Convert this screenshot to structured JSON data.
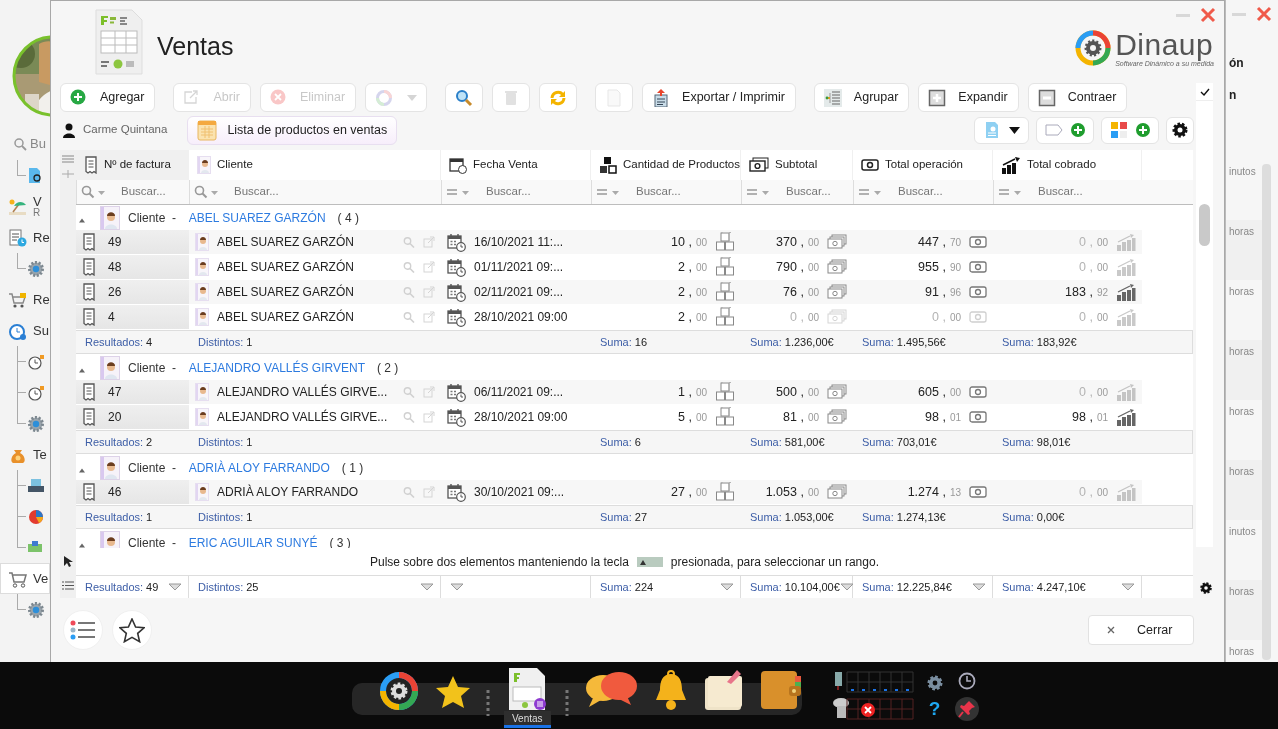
{
  "sidebar": {
    "search_placeholder": "Bu",
    "top_children": [
      {
        "kind": "document"
      }
    ],
    "items": [
      {
        "label": "V",
        "sublabel": "R",
        "kind": "beach",
        "selected": false
      },
      {
        "label": "Re",
        "kind": "report",
        "selected": false,
        "children": [
          {
            "kind": "gear"
          }
        ]
      },
      {
        "label": "Re",
        "kind": "cart-lock",
        "selected": false
      },
      {
        "label": "Su",
        "kind": "clock-gear",
        "selected": false,
        "children": [
          {
            "kind": "clock"
          },
          {
            "kind": "clock"
          },
          {
            "kind": "gear"
          }
        ]
      },
      {
        "label": "Te",
        "kind": "money-bag",
        "selected": false,
        "children": [
          {
            "kind": "register"
          },
          {
            "kind": "pie"
          },
          {
            "kind": "cash"
          }
        ]
      },
      {
        "label": "Ve",
        "kind": "cart",
        "selected": true,
        "children": [
          {
            "kind": "gear"
          }
        ]
      }
    ]
  },
  "window": {
    "title": "Ventas",
    "logo": {
      "name": "Dinaup",
      "tagline": "Software Dinámico a su medida"
    }
  },
  "toolbar": [
    {
      "kind": "add",
      "label": "Agregar",
      "disabled": false
    },
    {
      "kind": "open",
      "label": "Abrir",
      "disabled": true
    },
    {
      "kind": "delete",
      "label": "Eliminar",
      "disabled": true
    },
    {
      "kind": "color",
      "disabled": true
    },
    {
      "kind": "search",
      "disabled": false
    },
    {
      "kind": "trash",
      "disabled": true
    },
    {
      "kind": "refresh",
      "disabled": false
    },
    {
      "kind": "document",
      "disabled": true
    },
    {
      "kind": "export",
      "label": "Exportar / Imprimir",
      "disabled": false
    },
    {
      "kind": "group",
      "label": "Agrupar",
      "disabled": false
    },
    {
      "kind": "expand",
      "label": "Expandir",
      "disabled": false
    },
    {
      "kind": "collapse",
      "label": "Contraer",
      "disabled": false
    }
  ],
  "user": "Carme Quintana",
  "tab": {
    "label": "Lista de productos en ventas",
    "selected": true
  },
  "tools": [
    {
      "kind": "document-menu"
    },
    {
      "kind": "tag-add"
    },
    {
      "kind": "calc-add"
    },
    {
      "kind": "settings"
    }
  ],
  "show_panel": {
    "checked": true
  },
  "table": {
    "columns": [
      {
        "label": "Nº de factura",
        "kind": "search",
        "placeholder": "Buscar..."
      },
      {
        "label": "Cliente",
        "kind": "search",
        "placeholder": "Buscar..."
      },
      {
        "label": "Fecha Venta",
        "kind": "equals",
        "placeholder": "Buscar..."
      },
      {
        "label": "Cantidad de Productos",
        "kind": "equals",
        "placeholder": "Buscar..."
      },
      {
        "label": "Subtotal",
        "kind": "equals",
        "placeholder": "Buscar..."
      },
      {
        "label": "Total operación",
        "kind": "equals",
        "placeholder": "Buscar..."
      },
      {
        "label": "Total cobrado",
        "kind": "equals",
        "placeholder": "Buscar..."
      }
    ],
    "groups": [
      {
        "label": "Cliente",
        "separator": "-",
        "name": "ABEL SUAREZ GARZÓN",
        "count": "( 4 )",
        "expanded": true,
        "rows": [
          {
            "number": "49",
            "client": "ABEL SUAREZ GARZÓN",
            "date": "16/10/2021 11:...",
            "qty": {
              "whole": "10 ,",
              "cents": "00"
            },
            "subtotal": {
              "whole": "370 ,",
              "cents": "00",
              "muted": false
            },
            "total": {
              "whole": "447 ,",
              "cents": "70",
              "muted": false
            },
            "paid": {
              "whole": "0 ,",
              "cents": "00",
              "muted": true
            }
          },
          {
            "number": "48",
            "client": "ABEL SUAREZ GARZÓN",
            "date": "01/11/2021 09:...",
            "qty": {
              "whole": "2 ,",
              "cents": "00"
            },
            "subtotal": {
              "whole": "790 ,",
              "cents": "00",
              "muted": false
            },
            "total": {
              "whole": "955 ,",
              "cents": "90",
              "muted": false
            },
            "paid": {
              "whole": "0 ,",
              "cents": "00",
              "muted": true
            }
          },
          {
            "number": "26",
            "client": "ABEL SUAREZ GARZÓN",
            "date": "02/11/2021 09:...",
            "qty": {
              "whole": "2 ,",
              "cents": "00"
            },
            "subtotal": {
              "whole": "76 ,",
              "cents": "00",
              "muted": false
            },
            "total": {
              "whole": "91 ,",
              "cents": "96",
              "muted": false
            },
            "paid": {
              "whole": "183 ,",
              "cents": "92",
              "muted": false
            }
          },
          {
            "number": "4",
            "client": "ABEL SUAREZ GARZÓN",
            "date": "28/10/2021 09:00",
            "qty": {
              "whole": "2 ,",
              "cents": "00"
            },
            "subtotal": {
              "whole": "0 ,",
              "cents": "00",
              "muted": true
            },
            "total": {
              "whole": "0 ,",
              "cents": "00",
              "muted": true
            },
            "paid": {
              "whole": "0 ,",
              "cents": "00",
              "muted": true
            }
          }
        ],
        "footer": [
          {
            "label": "Resultados:",
            "value": "4"
          },
          {
            "label": "Distintos:",
            "value": "1"
          },
          {
            "label": "Suma:",
            "value": "16"
          },
          {
            "label": "Suma:",
            "value": "1.236,00€"
          },
          {
            "label": "Suma:",
            "value": "1.495,56€"
          },
          {
            "label": "Suma:",
            "value": "183,92€"
          }
        ]
      },
      {
        "label": "Cliente",
        "separator": "-",
        "name": "ALEJANDRO VALLÉS GIRVENT",
        "count": "( 2 )",
        "expanded": true,
        "rows": [
          {
            "number": "47",
            "client": "ALEJANDRO VALLÉS GIRVE...",
            "date": "06/11/2021 09:...",
            "qty": {
              "whole": "1 ,",
              "cents": "00"
            },
            "subtotal": {
              "whole": "500 ,",
              "cents": "00",
              "muted": false
            },
            "total": {
              "whole": "605 ,",
              "cents": "00",
              "muted": false
            },
            "paid": {
              "whole": "0 ,",
              "cents": "00",
              "muted": true
            }
          },
          {
            "number": "20",
            "client": "ALEJANDRO VALLÉS GIRVE...",
            "date": "28/10/2021 09:00",
            "qty": {
              "whole": "5 ,",
              "cents": "00"
            },
            "subtotal": {
              "whole": "81 ,",
              "cents": "00",
              "muted": false
            },
            "total": {
              "whole": "98 ,",
              "cents": "01",
              "muted": false
            },
            "paid": {
              "whole": "98 ,",
              "cents": "01",
              "muted": false
            }
          }
        ],
        "footer": [
          {
            "label": "Resultados:",
            "value": "2"
          },
          {
            "label": "Distintos:",
            "value": "1"
          },
          {
            "label": "Suma:",
            "value": "6"
          },
          {
            "label": "Suma:",
            "value": "581,00€"
          },
          {
            "label": "Suma:",
            "value": "703,01€"
          },
          {
            "label": "Suma:",
            "value": "98,01€"
          }
        ]
      },
      {
        "label": "Cliente",
        "separator": "-",
        "name": "ADRIÀ ALOY FARRANDO",
        "count": "( 1 )",
        "expanded": true,
        "rows": [
          {
            "number": "46",
            "client": "ADRIÀ ALOY FARRANDO",
            "date": "30/10/2021 09:...",
            "qty": {
              "whole": "27 ,",
              "cents": "00"
            },
            "subtotal": {
              "whole": "1.053 ,",
              "cents": "00",
              "muted": false
            },
            "total": {
              "whole": "1.274 ,",
              "cents": "13",
              "muted": false
            },
            "paid": {
              "whole": "0 ,",
              "cents": "00",
              "muted": true
            }
          }
        ],
        "footer": [
          {
            "label": "Resultados:",
            "value": "1"
          },
          {
            "label": "Distintos:",
            "value": "1"
          },
          {
            "label": "Suma:",
            "value": "27"
          },
          {
            "label": "Suma:",
            "value": "1.053,00€"
          },
          {
            "label": "Suma:",
            "value": "1.274,13€"
          },
          {
            "label": "Suma:",
            "value": "0,00€"
          }
        ]
      },
      {
        "label": "Cliente",
        "separator": "-",
        "name": "ERIC AGUILAR SUNYÉ",
        "count": "( 3 )",
        "expanded": true
      }
    ],
    "hint": {
      "before": "Pulse sobre dos elementos manteniendo la tecla",
      "after": "presionada, para seleccionar un rango."
    },
    "totals": [
      {
        "label": "Resultados:",
        "value": "49"
      },
      {
        "label": "Distintos:",
        "value": "25"
      },
      {
        "label": "Suma:",
        "value": "224"
      },
      {
        "label": "Suma:",
        "value": "10.104,00€"
      },
      {
        "label": "Suma:",
        "value": "12.225,84€"
      },
      {
        "label": "Suma:",
        "value": "4.247,10€"
      }
    ]
  },
  "close_button": "Cerrar",
  "right_panel": {
    "lines": [
      "ón",
      "n"
    ],
    "times": [
      "inutos",
      "horas",
      "horas",
      "horas",
      "horas",
      "horas",
      "inutos",
      "horas",
      "horas"
    ]
  },
  "taskbar": {
    "apps": [
      {
        "kind": "dinaup",
        "selected": false
      },
      {
        "kind": "star",
        "selected": false
      },
      {
        "kind": "ventas",
        "label": "Ventas",
        "selected": true
      },
      {
        "kind": "chat",
        "selected": false
      },
      {
        "kind": "bell",
        "selected": false
      },
      {
        "kind": "note",
        "selected": false
      },
      {
        "kind": "wallet",
        "selected": false
      }
    ],
    "help": "?"
  }
}
